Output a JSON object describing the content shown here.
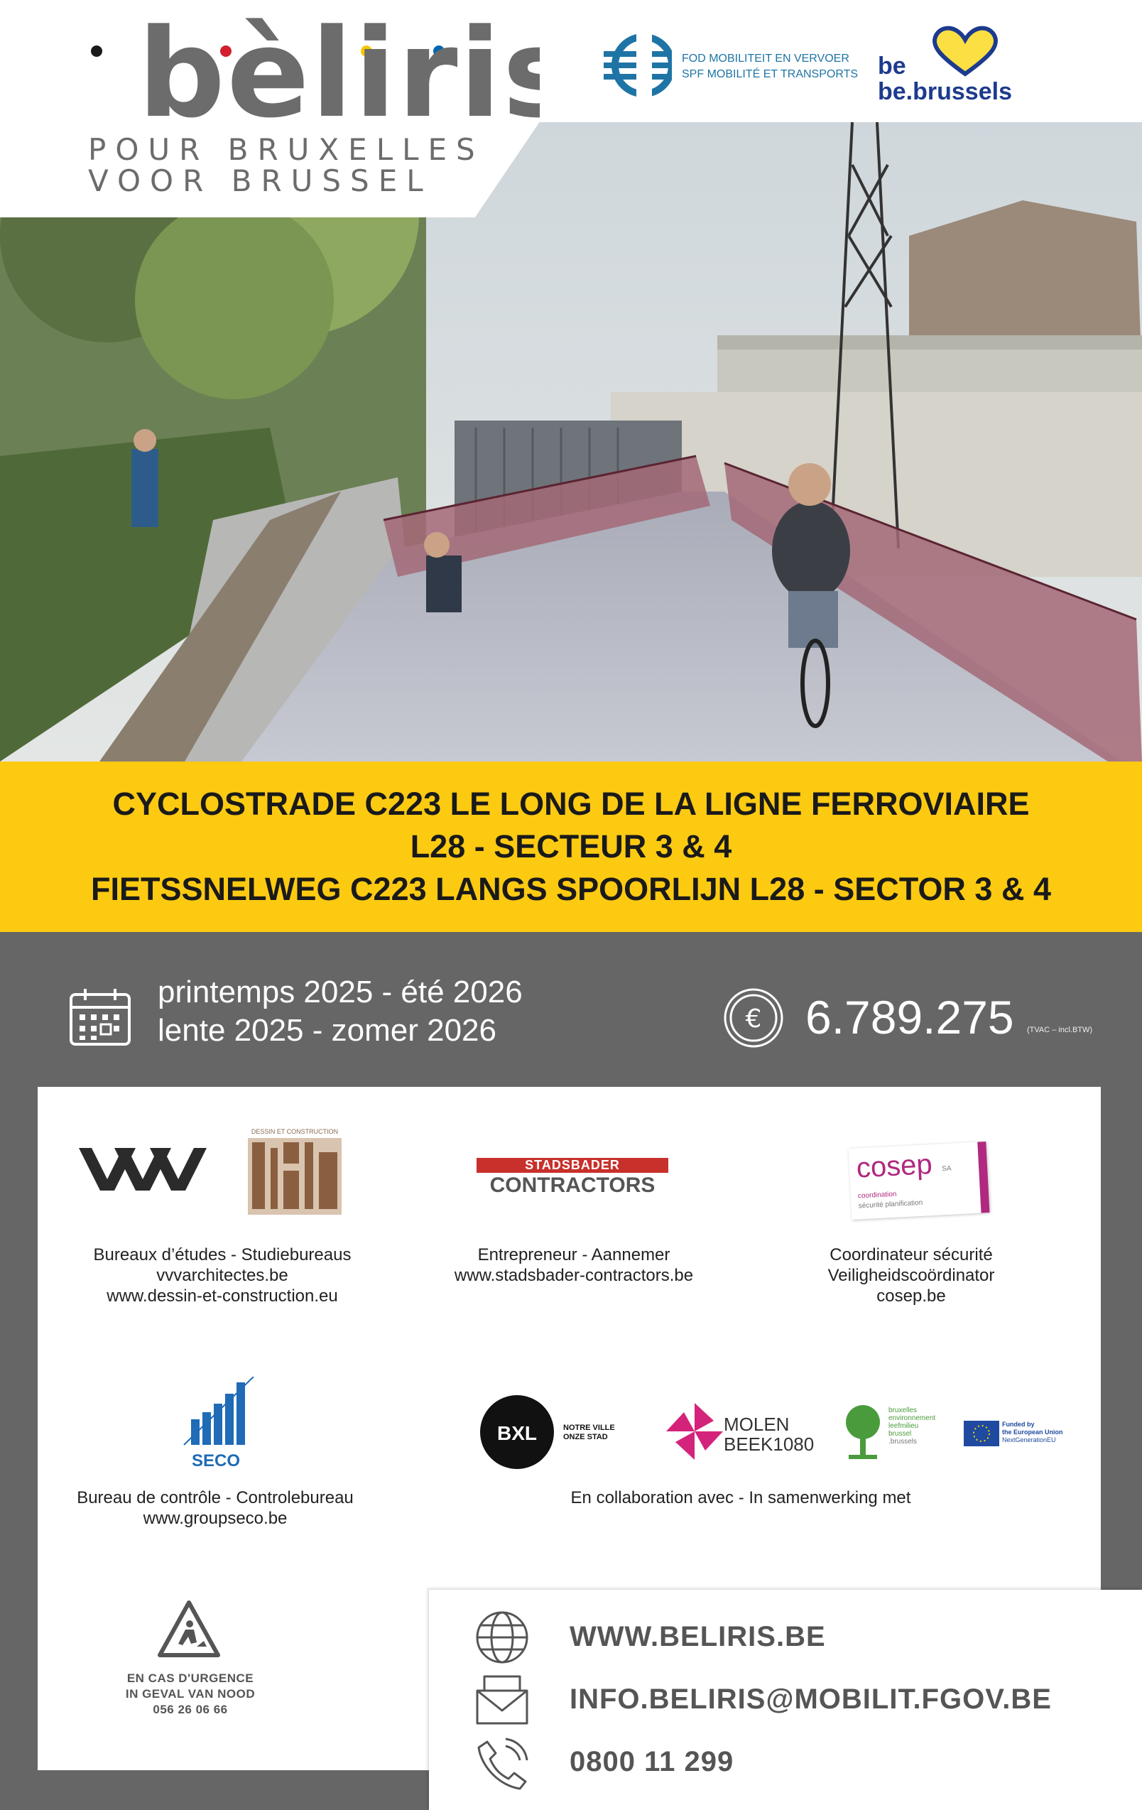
{
  "brand": {
    "logo": "bèliris",
    "tagline_fr": "POUR BRUXELLES",
    "tagline_nl": "VOOR BRUSSEL",
    "dot_colors": [
      "#1a1a1a",
      "#f6c800",
      "#d1202f",
      "#f6c800",
      "#0067b1"
    ]
  },
  "sponsors": {
    "fod_line1": "FOD MOBILITEIT EN VERVOER",
    "spf_line2": "SPF MOBILITÉ ET TRANSPORTS",
    "be_label": "be",
    "brussels_label": "be.brussels"
  },
  "title": {
    "line1": "CYCLOSTRADE C223 LE LONG DE LA LIGNE FERROVIAIRE",
    "line2": "L28 - SECTEUR 3 & 4",
    "line3": "FIETSSNELWEG C223 LANGS SPOORLIJN L28 - SECTOR 3 & 4"
  },
  "schedule": {
    "fr": "printemps 2025 - été 2026",
    "nl": "lente 2025 - zomer 2026"
  },
  "budget": {
    "amount": "6.789.275",
    "note": "(TVAC – incl.BTW)"
  },
  "partners": {
    "studies": {
      "logo_text": "DESSIN ET CONSTRUCTION",
      "caption": [
        "Bureaux d’études - Studiebureaus",
        "vvvarchitectes.be",
        "www.dessin-et-construction.eu"
      ]
    },
    "contractor": {
      "logo_top": "STADSBADER",
      "logo_bottom": "CONTRACTORS",
      "caption": [
        "Entrepreneur - Aannemer",
        "www.stadsbader-contractors.be"
      ]
    },
    "safety": {
      "logo_main": "cosep",
      "logo_sa": "SA",
      "logo_sub1": "coordination",
      "logo_sub2": "sécurité planification",
      "caption": [
        "Coordinateur sécurité",
        "Veiligheidscoördinator",
        "cosep.be"
      ]
    },
    "control": {
      "logo_text": "SECO",
      "caption": [
        "Bureau de contrôle - Controlebureau",
        "www.groupseco.be"
      ]
    },
    "collab": {
      "bxl": "BXL",
      "bxl_tag1": "NOTRE VILLE",
      "bxl_tag2": "ONZE STAD",
      "molen1": "MOLEN",
      "molen2": "BEEK1080",
      "env1": "bruxelles",
      "env2": "environnement",
      "env3": "leefmilieu",
      "env4": "brussel",
      "env5": ".brussels",
      "eu1": "Funded by",
      "eu2": "the European Union",
      "eu3": "NextGenerationEU",
      "caption": "En collaboration avec - In samenwerking met"
    }
  },
  "emergency": {
    "line1": "EN CAS D'URGENCE",
    "line2": "IN GEVAL VAN NOOD",
    "phone": "056 26 06 66"
  },
  "contact": {
    "website": "WWW.BELIRIS.BE",
    "email": "INFO.BELIRIS@MOBILIT.FGOV.BE",
    "phone": "0800 11 299"
  },
  "colors": {
    "yellow": "#fdca12",
    "grey": "#666666",
    "text_grey": "#6c6c6c"
  }
}
